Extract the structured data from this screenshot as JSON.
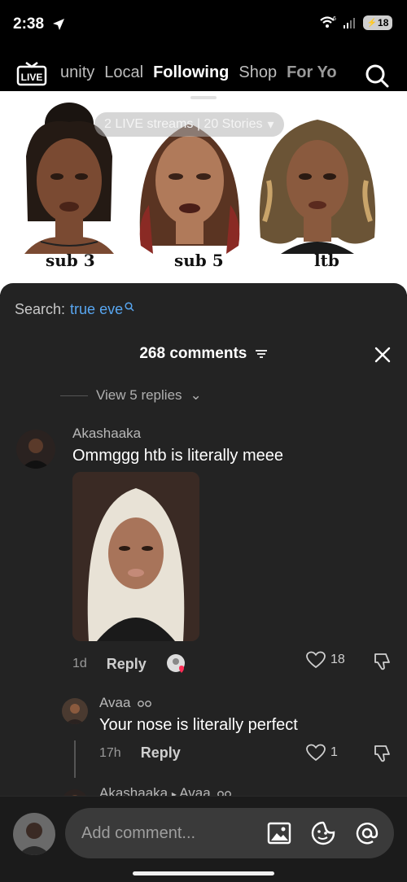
{
  "status_bar": {
    "time": "2:38",
    "wifi_badge": "6",
    "battery": "18"
  },
  "top_nav": {
    "live_label": "LIVE",
    "tabs": [
      {
        "label": "unity"
      },
      {
        "label": "Local"
      },
      {
        "label": "Following"
      },
      {
        "label": "Shop"
      },
      {
        "label": "For Yo"
      }
    ]
  },
  "feed": {
    "live_pill": "2 LIVE streams | 20 Stories",
    "labels": [
      "sub 3",
      "sub 5",
      "ltb"
    ]
  },
  "comments_sheet": {
    "search_label": "Search:",
    "search_term": "true eve",
    "header_title": "268 comments",
    "view_replies": "View 5 replies",
    "comment_1": {
      "username": "Akashaaka",
      "text": "Ommggg htb is literally meee",
      "time": "1d",
      "reply_label": "Reply",
      "likes": "18"
    },
    "reply_1": {
      "username": "Avaa",
      "text": "Your nose is literally perfect",
      "time": "17h",
      "reply_label": "Reply",
      "likes": "1"
    },
    "reply_2": {
      "username": "Akashaaka",
      "reply_to": "Avaa"
    }
  },
  "bottom_bar": {
    "placeholder": "Add comment..."
  },
  "colors": {
    "sheet_bg": "#232323",
    "search_term": "#58a6f0",
    "accent_heart": "#fe2c55"
  }
}
